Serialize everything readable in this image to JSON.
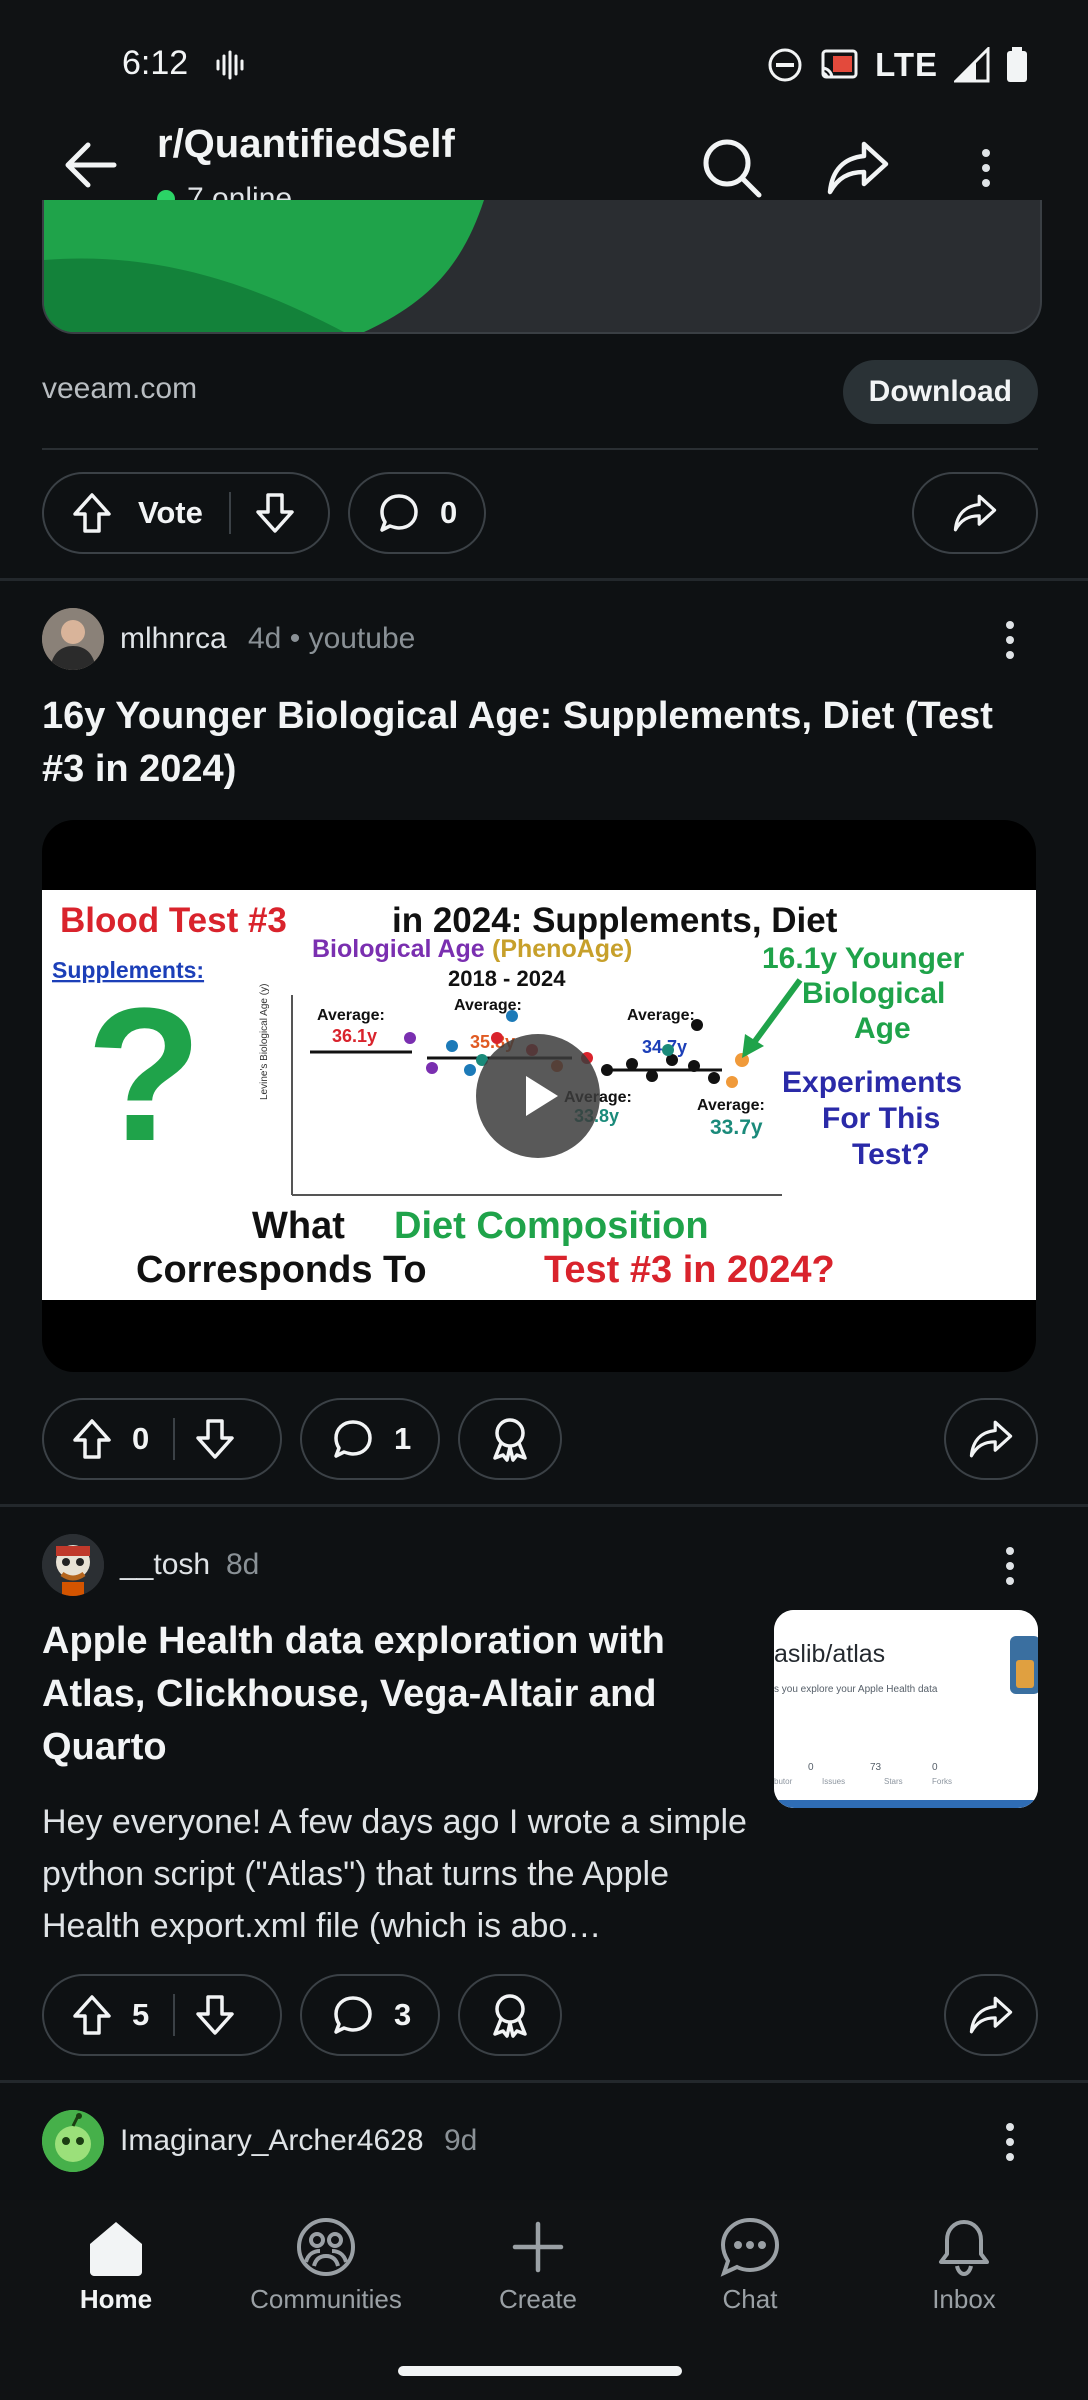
{
  "status_bar": {
    "time": "6:12",
    "network": "LTE"
  },
  "header": {
    "subreddit": "r/QuantifiedSelf",
    "online": "7 online"
  },
  "ad": {
    "source": "veeam.com",
    "cta": "Download",
    "vote_label": "Vote",
    "comments": "0"
  },
  "posts": [
    {
      "author": "mlhnrca",
      "age": "4d",
      "source": "youtube",
      "title": "16y Younger Biological Age: Supplements, Diet (Test #3 in 2024)",
      "score": "0",
      "comments": "1",
      "thumbnail": {
        "headline_a": "Blood Test #3",
        "headline_b": " in 2024: Supplements, Diet",
        "supplements": "Supplements:",
        "chart_title_a": "Biological Age ",
        "chart_title_b": "(PhenoAge)",
        "chart_years": "2018 - 2024",
        "avg1_label": "Average:",
        "avg1_value": "36.1y",
        "avg2_label": "Average:",
        "avg2_value": "35.8y",
        "avg3_label": "Average:",
        "avg3_value": "34.7y",
        "avg4_label": "Average:",
        "avg4_value": "33.8y",
        "avg5_label": "Average:",
        "avg5_value": "33.7y",
        "younger_1": "16.1y Younger",
        "younger_2": "Biological",
        "younger_3": "Age",
        "exp_1": "Experiments",
        "exp_2": "For This",
        "exp_3": "Test?",
        "bottom_1a": "What ",
        "bottom_1b": "Diet Composition",
        "bottom_2a": "Corresponds To ",
        "bottom_2b": "Test #3 in 2024?"
      }
    },
    {
      "author": "__tosh",
      "age": "8d",
      "title": "Apple Health data exploration with Atlas, Clickhouse, Vega-Altair and Quarto",
      "body": "Hey everyone! A few days ago I wrote a simple python script (\"Atlas\") that turns the Apple Health export.xml file (which is abo…",
      "score": "5",
      "comments": "3",
      "thumbnail": {
        "repo": "aslib/atlas",
        "desc": "s you explore your Apple Health data",
        "stat1_value": "0",
        "stat1_label": "Issues",
        "stat2_value": "73",
        "stat2_label": "Stars",
        "stat3_value": "0",
        "stat3_label": "Forks",
        "stat0_label": "butor"
      }
    },
    {
      "author": "Imaginary_Archer4628",
      "age": "9d"
    }
  ],
  "bottom_nav": [
    "Home",
    "Communities",
    "Create",
    "Chat",
    "Inbox"
  ],
  "colors": {
    "background": "#0e1113",
    "online_dot": "#2bd466",
    "accent_green": "#1fa34a"
  }
}
